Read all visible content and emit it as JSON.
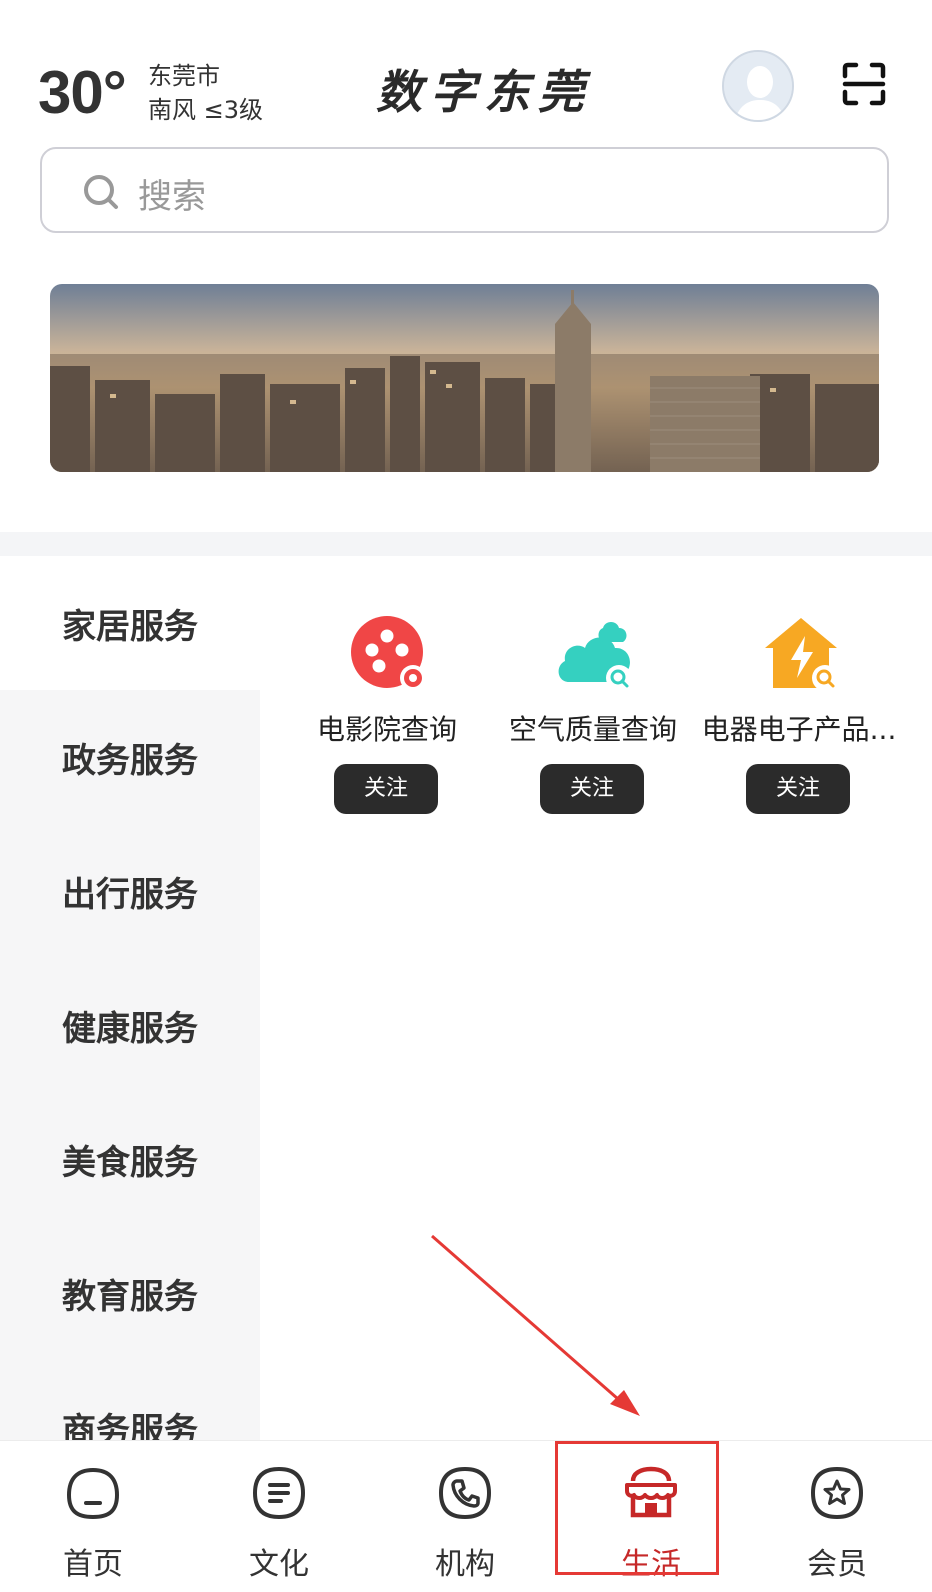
{
  "header": {
    "temperature": "30°",
    "city": "东莞市",
    "wind": "南风 ≤3级",
    "app_title": "数字东莞"
  },
  "search": {
    "placeholder": "搜索"
  },
  "sidebar": {
    "items": [
      {
        "label": "家居服务",
        "active": true
      },
      {
        "label": "政务服务",
        "active": false
      },
      {
        "label": "出行服务",
        "active": false
      },
      {
        "label": "健康服务",
        "active": false
      },
      {
        "label": "美食服务",
        "active": false
      },
      {
        "label": "教育服务",
        "active": false
      },
      {
        "label": "商务服务",
        "active": false
      }
    ]
  },
  "services": [
    {
      "label": "电影院查询",
      "button": "关注",
      "icon": "film-reel-icon",
      "color": "#f04646"
    },
    {
      "label": "空气质量查询",
      "button": "关注",
      "icon": "cloud-search-icon",
      "color": "#35d0c0"
    },
    {
      "label": "电器电子产品...",
      "button": "关注",
      "icon": "house-bolt-icon",
      "color": "#f7a823"
    }
  ],
  "bottom_nav": {
    "items": [
      {
        "label": "首页",
        "icon": "home-face-icon"
      },
      {
        "label": "文化",
        "icon": "document-lines-icon"
      },
      {
        "label": "机构",
        "icon": "phone-icon"
      },
      {
        "label": "生活",
        "icon": "shop-awning-icon",
        "active": true
      },
      {
        "label": "会员",
        "icon": "star-badge-icon"
      }
    ]
  },
  "colors": {
    "accent": "#c62828",
    "annotation": "#e53935",
    "button_bg": "#2b2b2b"
  }
}
